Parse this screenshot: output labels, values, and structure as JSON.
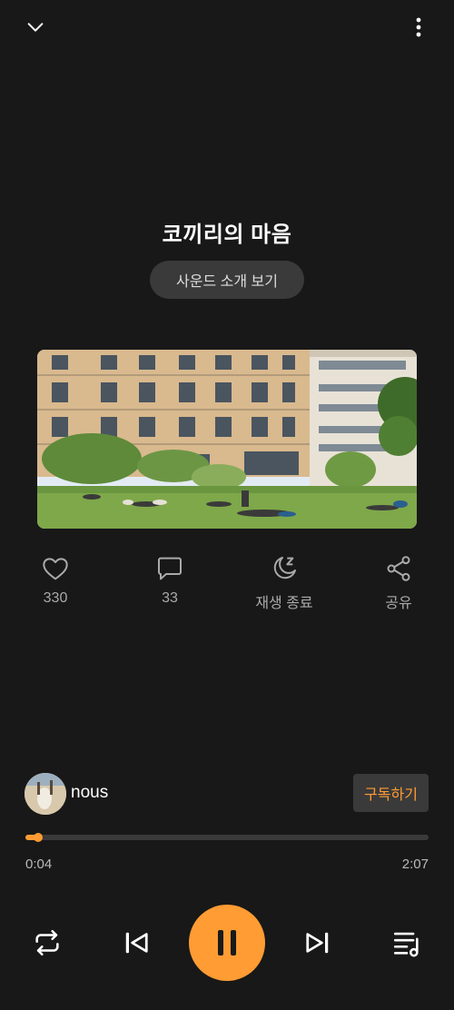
{
  "track": {
    "title": "코끼리의 마음",
    "intro_button": "사운드 소개 보기"
  },
  "actions": {
    "like_count": "330",
    "comment_count": "33",
    "sleep_label": "재생 종료",
    "share_label": "공유"
  },
  "channel": {
    "name": "nous",
    "subscribe_label": "구독하기"
  },
  "player": {
    "current_time": "0:04",
    "total_time": "2:07",
    "progress_fraction": 0.032
  },
  "colors": {
    "accent": "#ff9c33",
    "background": "#181818"
  },
  "icons": [
    "chevron-down-icon",
    "more-vert-icon",
    "heart-icon",
    "comment-icon",
    "sleep-timer-icon",
    "share-icon",
    "repeat-icon",
    "previous-icon",
    "pause-icon",
    "next-icon",
    "playlist-icon"
  ]
}
